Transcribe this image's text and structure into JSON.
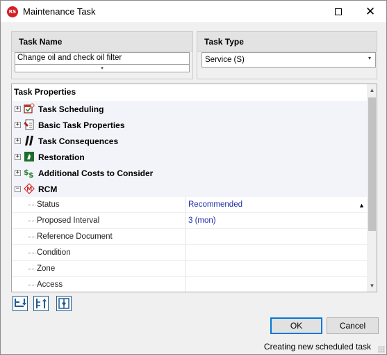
{
  "window": {
    "title": "Maintenance Task",
    "logo_text": "RS",
    "close_glyph": "✕"
  },
  "task_name": {
    "header": "Task Name",
    "value": "Change oil and check oil filter",
    "dropdown_glyph": "▾"
  },
  "task_type": {
    "header": "Task Type",
    "value": "Service (S)",
    "dropdown_glyph": "▾"
  },
  "properties": {
    "header": "Task Properties",
    "categories": [
      {
        "label": "Task Scheduling",
        "icon": "calendar-check-icon",
        "expanded": false
      },
      {
        "label": "Basic Task Properties",
        "icon": "wrench-document-icon",
        "expanded": false
      },
      {
        "label": "Task Consequences",
        "icon": "lightning-bolt-icon",
        "expanded": false
      },
      {
        "label": "Restoration",
        "icon": "restoration-icon",
        "expanded": false
      },
      {
        "label": "Additional Costs to Consider",
        "icon": "dollar-costs-icon",
        "expanded": false
      },
      {
        "label": "RCM",
        "icon": "rcm-m-icon",
        "expanded": true
      }
    ],
    "rcm_rows": [
      {
        "label": "Status",
        "value": "Recommended"
      },
      {
        "label": "Proposed Interval",
        "value": "3 (mon)"
      },
      {
        "label": "Reference Document",
        "value": ""
      },
      {
        "label": "Condition",
        "value": ""
      },
      {
        "label": "Zone",
        "value": ""
      },
      {
        "label": "Access",
        "value": ""
      }
    ],
    "expand_glyph": "+",
    "collapse_glyph": "−",
    "sort_glyph": "▲"
  },
  "toolbar": {
    "expand_all_icon": "expand-all-icon",
    "collapse_all_icon": "collapse-all-icon",
    "toggle_description_icon": "description-panel-icon"
  },
  "buttons": {
    "ok": "OK",
    "cancel": "Cancel"
  },
  "status": "Creating new scheduled task",
  "colors": {
    "value_text": "#1f2fa8",
    "category_row": "#f3f3fa",
    "logo_red": "#d42127",
    "focus_blue": "#0078d7"
  }
}
